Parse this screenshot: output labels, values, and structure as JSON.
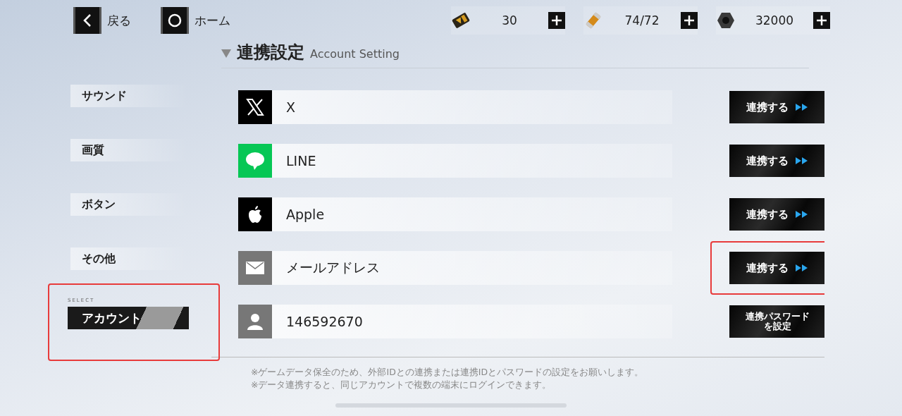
{
  "nav": [
    {
      "kind": "back",
      "label": "戻る"
    },
    {
      "kind": "home",
      "label": "ホーム"
    }
  ],
  "resources": [
    {
      "kind": "ticket",
      "value": "30"
    },
    {
      "kind": "capsule",
      "value": "74/72"
    },
    {
      "kind": "nut",
      "value": "32000"
    }
  ],
  "sidebar": {
    "items": [
      {
        "label": "サウンド",
        "selected": false,
        "highlighted": false
      },
      {
        "label": "画質",
        "selected": false,
        "highlighted": false
      },
      {
        "label": "ボタン",
        "selected": false,
        "highlighted": false
      },
      {
        "label": "その他",
        "selected": false,
        "highlighted": false
      },
      {
        "label": "アカウント",
        "selected": true,
        "highlighted": true,
        "tag": "SELECT"
      }
    ]
  },
  "section": {
    "title": "連携設定",
    "subtitle": "Account Setting"
  },
  "accounts": [
    {
      "kind": "x",
      "name": "X",
      "button": "連携する",
      "arrows": true,
      "highlighted": false
    },
    {
      "kind": "line",
      "name": "LINE",
      "button": "連携する",
      "arrows": true,
      "highlighted": false
    },
    {
      "kind": "apple",
      "name": "Apple",
      "button": "連携する",
      "arrows": true,
      "highlighted": false
    },
    {
      "kind": "mail",
      "name": "メールアドレス",
      "button": "連携する",
      "arrows": true,
      "highlighted": true
    },
    {
      "kind": "user",
      "name": "146592670",
      "button": "連携パスワードを設定",
      "arrows": false,
      "highlighted": false
    }
  ],
  "notes": [
    "※ゲームデータ保全のため、外部IDとの連携または連携IDとパスワードの設定をお願いします。",
    "※データ連携すると、同じアカウントで複数の端末にログインできます。"
  ]
}
